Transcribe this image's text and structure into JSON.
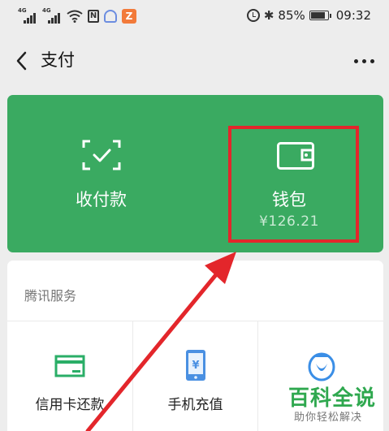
{
  "status_bar": {
    "signal_labels": [
      "4G",
      "4G"
    ],
    "battery_percent": "85%",
    "battery_level": 0.85,
    "time": "09:32",
    "icons": [
      "signal-icon",
      "signal-icon",
      "wifi-icon",
      "nfc-icon",
      "app-notification-icon",
      "app-notification-icon",
      "alarm-icon",
      "bluetooth-icon",
      "battery-icon"
    ]
  },
  "nav": {
    "title": "支付",
    "back_icon": "chevron-left-icon",
    "more_icon": "more-icon"
  },
  "actions": {
    "collect_label": "收付款",
    "collect_icon": "scan-icon",
    "wallet_label": "钱包",
    "wallet_balance": "¥126.21",
    "wallet_icon": "wallet-icon"
  },
  "services": {
    "title": "腾讯服务",
    "items": [
      {
        "label": "信用卡还款",
        "icon": "credit-card-icon"
      },
      {
        "label": "手机充值",
        "icon": "phone-topup-icon"
      },
      {
        "label": "",
        "icon": "qq-icon"
      }
    ]
  },
  "watermark": {
    "main": "百科全说",
    "sub": "助你轻松解决"
  },
  "colors": {
    "card_green": "#3aaa61",
    "highlight_red": "#e3262b",
    "watermark_green": "#2fa84f",
    "background": "#ededed"
  }
}
